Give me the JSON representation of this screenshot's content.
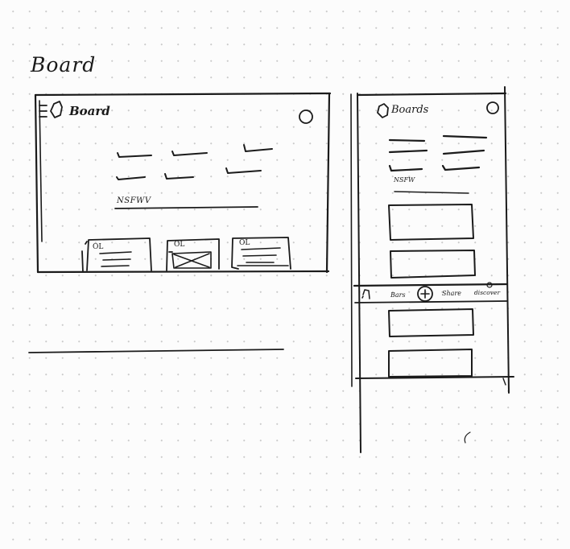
{
  "page_title": "Board",
  "desktop": {
    "title": "Board",
    "nav_item": "NSFWV",
    "card_badges": [
      "OL",
      "OL",
      "OL"
    ]
  },
  "mobile": {
    "title": "Boards",
    "nav_item": "NSFW",
    "bottom_bar": {
      "boards_label": "Bars",
      "add_label": "+",
      "share_label": "Share",
      "discover_label": "discover"
    }
  }
}
